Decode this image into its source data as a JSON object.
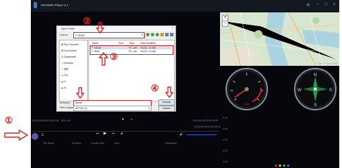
{
  "window": {
    "title": "AIDOMIN Player 2.1"
  },
  "dialog": {
    "title": "Open Folder",
    "look_in_label": "Look in:",
    "look_in_value": "C:\\DATA",
    "sidebar": [
      "My Computer",
      "Documents",
      "Downloads",
      "Desktop",
      "音乐",
      "PIC",
      "C:",
      "D:"
    ],
    "columns": [
      "Name",
      "Size",
      "Type",
      "Date Modified"
    ],
    "files": [
      {
        "name": "Movie",
        "size": "",
        "type": "Fil...der",
        "date": "9/1/21, 10 AM"
      },
      {
        "name": "BAK",
        "size": "",
        "type": "Fil...der",
        "date": "9/1/21, 10 AM"
      }
    ],
    "directory_label": "Directory:",
    "directory_value": "Movie",
    "type_label": "Files of type:",
    "type_value": "All Files (*)",
    "choose_label": "Choose",
    "cancel_label": "Cancel"
  },
  "annotations": {
    "n1": "①",
    "n2": "②",
    "n3": "③",
    "n4": "④"
  },
  "timeline": {
    "left_time": "00:00:00:00/00:00:00:00",
    "mid_label": "000 x:00",
    "right_time": "0:00:00:00/00:00:00:00",
    "right_time2": "00:00:00:00/00:00:00:00"
  },
  "table": {
    "columns": [
      "File Name",
      "Duration",
      "Create Date",
      "Size",
      "Resolution"
    ]
  },
  "gauge": {
    "speed_label": "km/h"
  },
  "side_labels": [
    "0.00",
    "0.00",
    "0.00",
    "0.00",
    "0.00"
  ],
  "map": {
    "attribution": "Leaflet | © OpenStreetMap"
  },
  "colors": {
    "annotation": "#e02020",
    "accent": "#1e6fd9",
    "app_bg": "#05070c"
  }
}
